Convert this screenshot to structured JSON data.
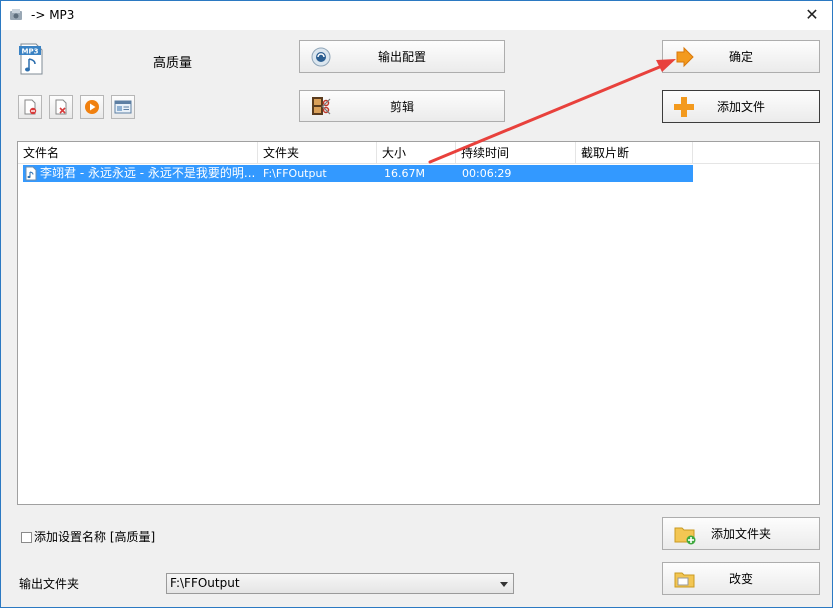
{
  "window": {
    "title": "-> MP3",
    "close_glyph": "✕"
  },
  "profile": {
    "format_icon_label": "MP3",
    "quality": "高质量"
  },
  "buttons": {
    "output_config": "输出配置",
    "clip": "剪辑",
    "ok": "确定",
    "add_file": "添加文件",
    "add_folder": "添加文件夹",
    "change": "改变"
  },
  "toolbar": [
    "remove-file-icon",
    "clear-list-icon",
    "play-icon",
    "media-info-icon"
  ],
  "list": {
    "columns": [
      "文件名",
      "文件夹",
      "大小",
      "持续时间",
      "截取片断"
    ],
    "rows": [
      {
        "name": "李翊君 - 永远永远 - 永远不是我要的明...",
        "folder": "F:\\FFOutput",
        "size": "16.67M",
        "duration": "00:06:29",
        "clip": ""
      }
    ]
  },
  "options": {
    "add_setting_name": "添加设置名称 [高质量]"
  },
  "output": {
    "label": "输出文件夹",
    "value": "F:\\FFOutput"
  },
  "colors": {
    "selection": "#3399ff",
    "arrow": "#e8413c",
    "accent_orange": "#f39a1e"
  }
}
